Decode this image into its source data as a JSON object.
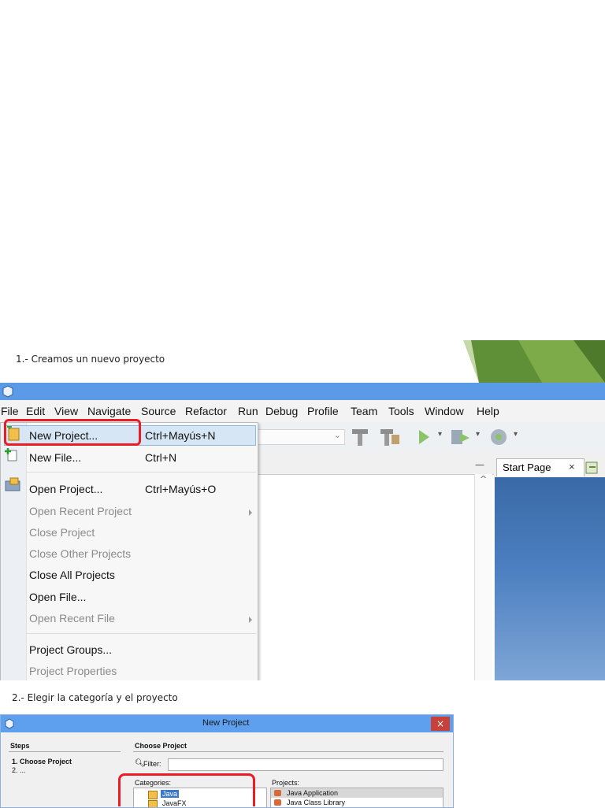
{
  "captions": {
    "step1": "1.- Creamos un nuevo proyecto",
    "step2": "2.- Elegir la categoría  y el proyecto"
  },
  "menubar": [
    "File",
    "Edit",
    "View",
    "Navigate",
    "Source",
    "Refactor",
    "Run",
    "Debug",
    "Profile",
    "Team",
    "Tools",
    "Window",
    "Help"
  ],
  "file_menu": {
    "items": [
      {
        "label": "New Project...",
        "shortcut": "Ctrl+Mayús+N",
        "enabled": true,
        "highlighted": true,
        "icon": "new-project-icon"
      },
      {
        "label": "New File...",
        "shortcut": "Ctrl+N",
        "enabled": true,
        "icon": "new-file-icon"
      },
      {
        "label": "Open Project...",
        "shortcut": "Ctrl+Mayús+O",
        "enabled": true,
        "icon": "open-project-icon"
      },
      {
        "label": "Open Recent Project",
        "enabled": false,
        "submenu": true
      },
      {
        "label": "Close Project",
        "enabled": false
      },
      {
        "label": "Close Other Projects",
        "enabled": false
      },
      {
        "label": "Close All Projects",
        "enabled": true
      },
      {
        "label": "Open File...",
        "enabled": true
      },
      {
        "label": "Open Recent File",
        "enabled": false,
        "submenu": true
      },
      {
        "label": "Project Groups...",
        "enabled": true
      },
      {
        "label": "Project Properties",
        "enabled": false
      }
    ]
  },
  "editor": {
    "start_tab": "Start Page",
    "close_glyph": "×",
    "minimize_glyph": "—",
    "scroll_up_glyph": "^"
  },
  "dialog": {
    "title": "New Project",
    "close_glyph": "×",
    "steps_heading": "Steps",
    "steps": [
      "1.   Choose Project",
      "2.   ..."
    ],
    "panel_heading": "Choose Project",
    "filter_label": "Filter:",
    "categories_label": "Categories:",
    "categories": [
      "Java",
      "JavaFX"
    ],
    "projects_label": "Projects:",
    "projects": [
      "Java Application",
      "Java Class Library"
    ]
  },
  "colors": {
    "highlight_red": "#ea1c24",
    "title_blue": "#5b9ae6",
    "deco_green": "#6b9a3a"
  }
}
